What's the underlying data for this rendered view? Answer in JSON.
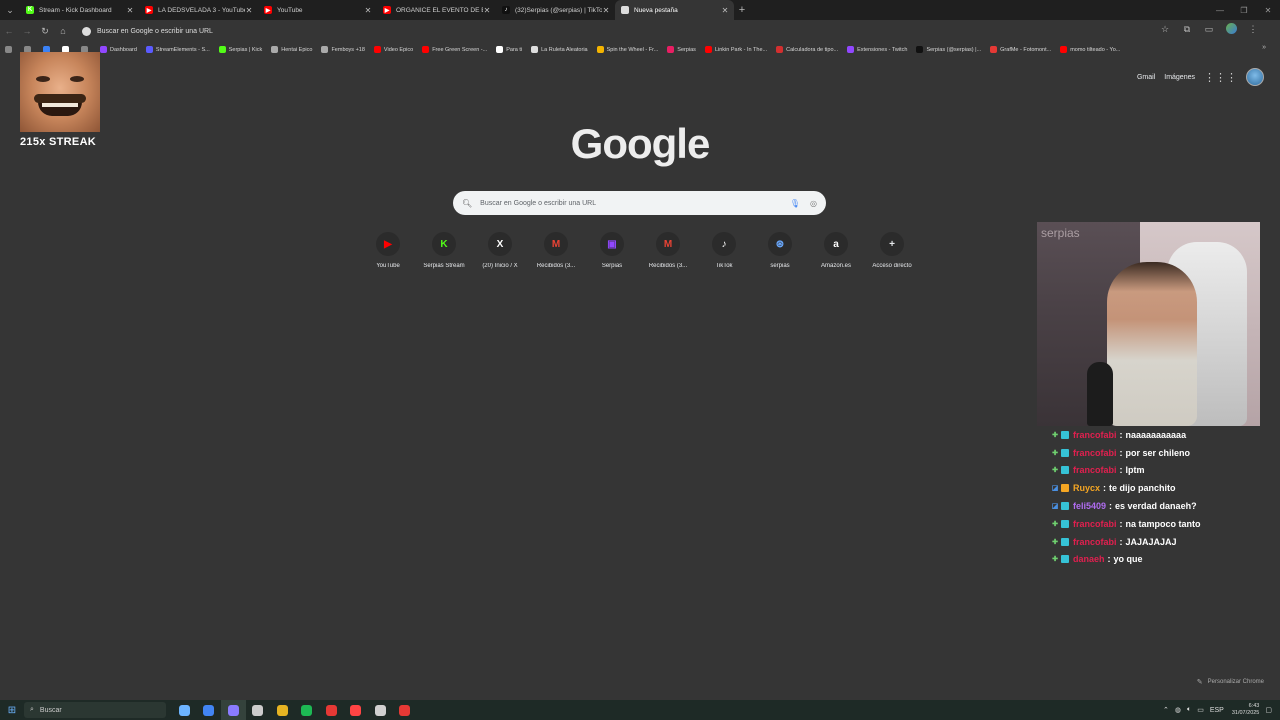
{
  "tabs": [
    {
      "title": "Stream - Kick Dashboard",
      "fav_color": "#53fc18",
      "fav_glyph": "K"
    },
    {
      "title": "LA DEDSVELADA 3 - YouTube",
      "fav_color": "#ff0000",
      "fav_glyph": "▶"
    },
    {
      "title": "YouTube",
      "fav_color": "#ff0000",
      "fav_glyph": "▶"
    },
    {
      "title": "ORGANICE EL EVENTO DE BOXEO",
      "fav_color": "#ff0000",
      "fav_glyph": "▶"
    },
    {
      "title": "(32)Serpias (@serpias) | TikTok",
      "fav_color": "#111111",
      "fav_glyph": "♪"
    },
    {
      "title": "Nueva pestaña",
      "fav_color": "#dddddd",
      "fav_glyph": ""
    }
  ],
  "omnibox": {
    "text": "Buscar en Google o escribir una URL"
  },
  "bookmarks": [
    {
      "label": "",
      "color": "#888888"
    },
    {
      "label": "",
      "color": "#888888"
    },
    {
      "label": "",
      "color": "#3b82f6"
    },
    {
      "label": "",
      "color": "#ffffff"
    },
    {
      "label": "",
      "color": "#888888"
    },
    {
      "label": "Dashboard",
      "color": "#9147ff"
    },
    {
      "label": "StreamElements - S...",
      "color": "#5b5bff"
    },
    {
      "label": "Serpias | Kick",
      "color": "#53fc18"
    },
    {
      "label": "Hentai Epico",
      "color": "#aaaaaa"
    },
    {
      "label": "Femboys +18",
      "color": "#aaaaaa"
    },
    {
      "label": "Video Epico",
      "color": "#ff0000"
    },
    {
      "label": "Free Green Screen -...",
      "color": "#ff0000"
    },
    {
      "label": "Para ti",
      "color": "#ffffff"
    },
    {
      "label": "La Ruleta Aleatoria",
      "color": "#dddddd"
    },
    {
      "label": "Spin the Wheel - Fr...",
      "color": "#f4b400"
    },
    {
      "label": "Serpias",
      "color": "#e91e63"
    },
    {
      "label": "Linkin Park - In The...",
      "color": "#ff0000"
    },
    {
      "label": "Calculadora de tipo...",
      "color": "#d32f2f"
    },
    {
      "label": "Extensiones - Twitch",
      "color": "#9147ff"
    },
    {
      "label": "Serpias (@serpias) |...",
      "color": "#111111"
    },
    {
      "label": "GrafMe - Fotomont...",
      "color": "#e53935"
    },
    {
      "label": "momo tilteado - Yo...",
      "color": "#ff0000"
    }
  ],
  "toplinks": {
    "gmail": "Gmail",
    "images": "Imágenes"
  },
  "logo": "Google",
  "search": {
    "placeholder": "Buscar en Google o escribir una URL"
  },
  "shortcuts": [
    {
      "label": "YouTube",
      "glyph": "▶",
      "color": "#ff0000"
    },
    {
      "label": "Serpias Stream",
      "glyph": "K",
      "color": "#53fc18"
    },
    {
      "label": "(20) Inicio / X",
      "glyph": "X",
      "color": "#ffffff"
    },
    {
      "label": "Recibidos (3...",
      "glyph": "M",
      "color": "#ea4335"
    },
    {
      "label": "Serpias",
      "glyph": "▣",
      "color": "#9147ff"
    },
    {
      "label": "Recibidos (3...",
      "glyph": "M",
      "color": "#ea4335"
    },
    {
      "label": "TikTok",
      "glyph": "♪",
      "color": "#ffffff"
    },
    {
      "label": "serpias",
      "glyph": "⊛",
      "color": "#6aa9ff"
    },
    {
      "label": "Amazon.es",
      "glyph": "a",
      "color": "#ffffff"
    },
    {
      "label": "Acceso directo",
      "glyph": "+",
      "color": "#e8eaed"
    }
  ],
  "customize": "Personalizar Chrome",
  "streak": {
    "text": "215x STREAK"
  },
  "webcam": {
    "brand": "serpias"
  },
  "chat": [
    {
      "user": "francofabi",
      "color": "#e0204f",
      "text": "naaaaaaaaaaa",
      "b1": "#6fd16f",
      "b1g": "✚",
      "b2": "#36c2d6"
    },
    {
      "user": "francofabi",
      "color": "#e0204f",
      "text": "por ser chileno",
      "b1": "#6fd16f",
      "b1g": "✚",
      "b2": "#36c2d6"
    },
    {
      "user": "francofabi",
      "color": "#e0204f",
      "text": "lptm",
      "b1": "#6fd16f",
      "b1g": "✚",
      "b2": "#36c2d6"
    },
    {
      "user": "Ruycx",
      "color": "#f5a623",
      "text": "te dijo panchito",
      "b1": "#4a90e2",
      "b1g": "◪",
      "b2": "#f5a623"
    },
    {
      "user": "feli5409",
      "color": "#b06cf0",
      "text": "es verdad danaeh?",
      "b1": "#4a90e2",
      "b1g": "◪",
      "b2": "#36c2d6"
    },
    {
      "user": "francofabi",
      "color": "#e0204f",
      "text": "na tampoco tanto",
      "b1": "#6fd16f",
      "b1g": "✚",
      "b2": "#36c2d6"
    },
    {
      "user": "francofabi",
      "color": "#e0204f",
      "text": "JAJAJAJAJ",
      "b1": "#6fd16f",
      "b1g": "✚",
      "b2": "#36c2d6"
    },
    {
      "user": "danaeh",
      "color": "#e0204f",
      "text": "yo que",
      "b1": "#6fd16f",
      "b1g": "✚",
      "b2": "#36c2d6"
    }
  ],
  "taskbar": {
    "search": "Buscar",
    "apps": [
      "#6cb4ff",
      "#4285f4",
      "#8a7cff",
      "#cccccc",
      "#e6b422",
      "#1db954",
      "#e53935",
      "#ff4444",
      "#d0d0d0",
      "#e53935"
    ],
    "lang": "ESP",
    "time": "6:43",
    "date": "31/07/2025"
  }
}
